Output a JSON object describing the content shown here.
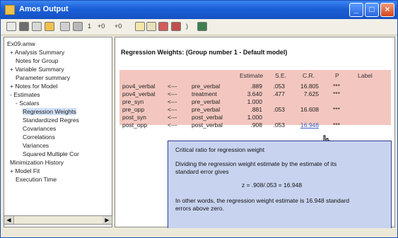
{
  "window": {
    "title": "Amos Output"
  },
  "toolbar": {
    "text1": "1",
    "text2": "+0",
    "text3": "+0",
    "text4": ")"
  },
  "sidebar": {
    "items": [
      "Ex09.amw",
      "+ Analysis Summary",
      "Notes for Group",
      "+ Variable Summary",
      "Parameter summary",
      "+ Notes for Model",
      "- Estimates",
      "- Scalars",
      "Regression Weights",
      "Standardized Regres",
      "Covariances",
      "Correlations",
      "Variances",
      "Squared Multiple Cor",
      "Minimization History",
      "+ Model Fit",
      "Execution Time"
    ]
  },
  "main": {
    "heading": "Regression Weights: (Group number 1 - Default model)",
    "columns": [
      "Estimate",
      "S.E.",
      "C.R.",
      "P",
      "Label"
    ],
    "rows": [
      [
        "pov4_verbal",
        "<---",
        "pre_verbal",
        ".889",
        ".053",
        "16.805",
        "***",
        ""
      ],
      [
        "pov4_verbal",
        "<---",
        "treatment",
        "3.640",
        ".477",
        "7.625",
        "***",
        ""
      ],
      [
        "pre_syn",
        "<---",
        "pre_verbal",
        "1.000",
        "",
        "",
        "",
        ""
      ],
      [
        "pre_opp",
        "<---",
        "pre_verbal",
        ".881",
        ".053",
        "16.608",
        "***",
        ""
      ],
      [
        "post_syn",
        "<---",
        "post_verbal",
        "1.000",
        "",
        "",
        "",
        ""
      ],
      [
        "post_opp",
        "<---",
        "post_verbal",
        ".908",
        ".053",
        "16.948",
        "***",
        ""
      ]
    ]
  },
  "tooltip": {
    "title": "Critical ratio for regression weight",
    "line1": "Dividing the regression weight estimate by the estimate of its",
    "line2": "standard error gives",
    "formula": "z = .908/.053 = 16.948",
    "line3": "In other words, the regression weight estimate is 16.948 standard",
    "line4": "errors above zero."
  }
}
